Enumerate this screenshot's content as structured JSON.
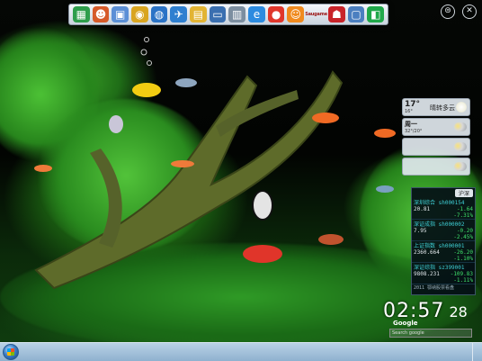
{
  "toolbar": {
    "items": [
      {
        "icon": "cube-icon",
        "glyph": "▦",
        "color": "#2e9e4c"
      },
      {
        "icon": "user-icon",
        "glyph": "☻",
        "color": "#d65a2a"
      },
      {
        "icon": "image-icon",
        "glyph": "▣",
        "color": "#5b8fd6"
      },
      {
        "icon": "light-icon",
        "glyph": "◉",
        "color": "#d9a521"
      },
      {
        "icon": "globe-icon",
        "glyph": "◍",
        "color": "#2b73c6"
      },
      {
        "icon": "plane-icon",
        "glyph": "✈",
        "color": "#2e7fd0"
      },
      {
        "icon": "document-icon",
        "glyph": "▤",
        "color": "#e2b434"
      },
      {
        "icon": "monitor-icon",
        "glyph": "▭",
        "color": "#3a6fb0"
      },
      {
        "icon": "recycle-bin-icon",
        "glyph": "▥",
        "color": "#7c8ea0"
      },
      {
        "icon": "ie-icon",
        "glyph": "e",
        "color": "#2c8be0"
      },
      {
        "icon": "color-ball-icon",
        "glyph": "●",
        "color": "#e0372c"
      },
      {
        "icon": "face-icon",
        "glyph": "☺",
        "color": "#f08a1e"
      },
      {
        "icon": "game-icon",
        "glyph": "",
        "color": "#c43b2a",
        "label": "Saugame"
      },
      {
        "icon": "qq-icon",
        "glyph": "☗",
        "color": "#c8242a"
      },
      {
        "icon": "computer-icon",
        "glyph": "▢",
        "color": "#4b7fc0"
      },
      {
        "icon": "app-icon",
        "glyph": "◧",
        "color": "#20a84a"
      }
    ]
  },
  "weather": {
    "today": {
      "temp": "17°",
      "range": "16°",
      "desc": "晴转多云"
    },
    "day2": {
      "label": "周一",
      "range": "32°/20°"
    },
    "day3": {
      "label": "",
      "range": ""
    }
  },
  "stocks": {
    "market": "沪深",
    "rows": [
      {
        "name": "深圳综合 sh000154",
        "value": "20.81",
        "change": "-1.64",
        "pct": "-7.31%",
        "dir": "down"
      },
      {
        "name": "深证成指 sh000002",
        "value": "7.95",
        "change": "-0.20",
        "pct": "-2.45%",
        "dir": "down"
      },
      {
        "name": "上证指数 sh000001",
        "value": "2360.664",
        "change": "-26.20",
        "pct": "-1.10%",
        "dir": "down"
      },
      {
        "name": "深证综指 sz399001",
        "value": "9808.231",
        "change": "-109.83",
        "pct": "-1.11%",
        "dir": "down"
      }
    ],
    "footer": "2011 鄂纳股票看盘"
  },
  "clock": {
    "hm": "02:57",
    "sec": "28"
  },
  "google": {
    "label": "Google",
    "search_placeholder": "Search google"
  },
  "top_buttons": [
    {
      "icon": "menu-icon",
      "glyph": "⊜"
    },
    {
      "icon": "close-icon",
      "glyph": "✕"
    }
  ],
  "colors": {
    "water": "#020402",
    "plants": "#2e9a22",
    "taskbar": "#9cbcd8"
  }
}
